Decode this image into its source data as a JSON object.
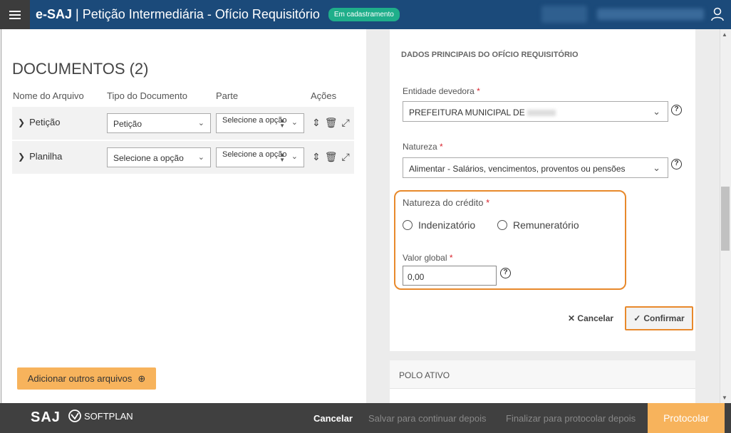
{
  "header": {
    "app": "e-SAJ",
    "separator": "|",
    "title": "Petição Intermediária - Ofício Requisitório",
    "badge": "Em cadastramento"
  },
  "documents": {
    "title": "DOCUMENTOS (2)",
    "columns": [
      "Nome do Arquivo",
      "Tipo do Documento",
      "Parte",
      "Ações"
    ],
    "rows": [
      {
        "name": "Petição",
        "type": "Petição",
        "party": "Selecione a opção"
      },
      {
        "name": "Planilha",
        "type": "Selecione a opção",
        "party": "Selecione a opção"
      }
    ],
    "add_button": "Adicionar outros arquivos"
  },
  "form": {
    "section_title": "DADOS PRINCIPAIS DO OFÍCIO REQUISITÓRIO",
    "entidade_label": "Entidade devedora",
    "entidade_value": "PREFEITURA MUNICIPAL DE",
    "natureza_label": "Natureza",
    "natureza_value": "Alimentar - Salários, vencimentos, proventos ou pensões",
    "natureza_credito_label": "Natureza do crédito",
    "radio_options": [
      "Indenizatório",
      "Remuneratório"
    ],
    "valor_global_label": "Valor global",
    "valor_global_value": "0,00",
    "required_mark": "*",
    "help_glyph": "?",
    "cancel_label": "Cancelar",
    "confirm_label": "Confirmar"
  },
  "polo_ativo": {
    "title": "POLO ATIVO"
  },
  "footer": {
    "logo_saj": "SAJ",
    "logo_softplan": "SOFTPLAN",
    "cancel": "Cancelar",
    "save_later": "Salvar para continuar depois",
    "finalize_later": "Finalizar para protocolar depois",
    "protocolar": "Protocolar"
  },
  "colors": {
    "header_bg": "#1b4a7a",
    "badge_bg": "#1fae8a",
    "accent_orange": "#f7b35c",
    "highlight_orange": "#e8892b",
    "footer_bg": "#404040"
  }
}
